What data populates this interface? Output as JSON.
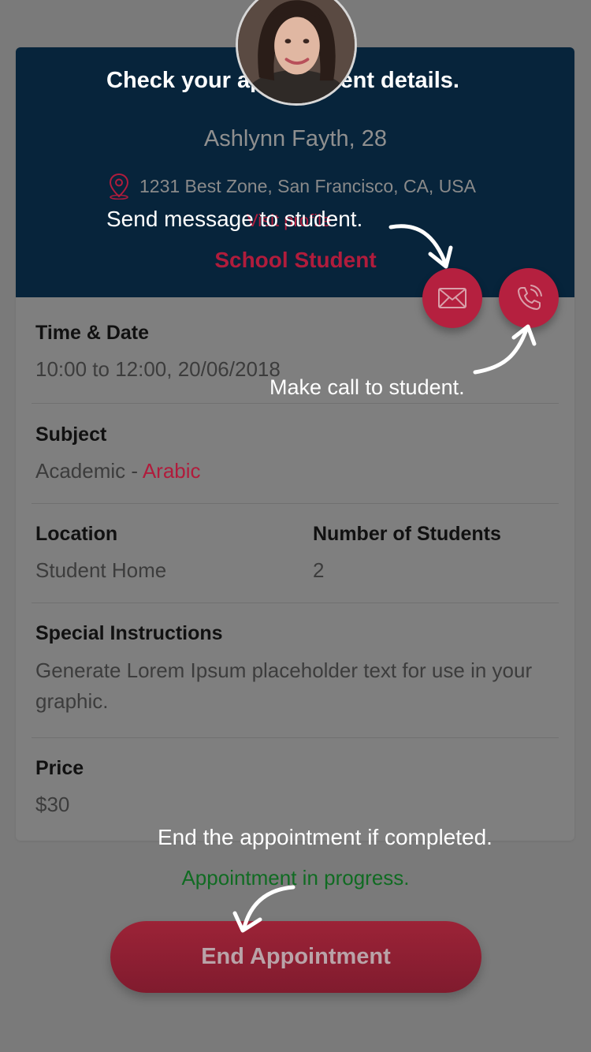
{
  "appointment": {
    "student_name": "Ashlynn Fayth, 28",
    "address": "1231 Best Zone, San Francisco, CA, USA",
    "visit_link": "Visit profile",
    "student_type": "School Student"
  },
  "details": {
    "time_date_label": "Time & Date",
    "time_date_value": "10:00 to 12:00, 20/06/2018",
    "subject_label": "Subject",
    "subject_category": "Academic",
    "subject_separator": " - ",
    "subject_name": "Arabic",
    "location_label": "Location",
    "location_value": "Student Home",
    "students_label": "Number of Students",
    "students_value": "2",
    "instructions_label": "Special Instructions",
    "instructions_value": "Generate Lorem Ipsum placeholder text for use in your graphic.",
    "price_label": "Price",
    "price_value": "$30"
  },
  "status": "Appointment in progress.",
  "end_button_label": "End Appointment",
  "annotations": {
    "title": "Check your appointment details.",
    "message": "Send message to student.",
    "call": "Make call to student.",
    "end": "End the appointment if completed."
  },
  "icons": {
    "message": "mail-icon",
    "call": "phone-icon",
    "location": "map-pin-icon"
  },
  "colors": {
    "header_bg": "#07243b",
    "accent": "#b01c3c",
    "status_green": "#106b22",
    "overlay_gray": "#7a7a7a"
  }
}
